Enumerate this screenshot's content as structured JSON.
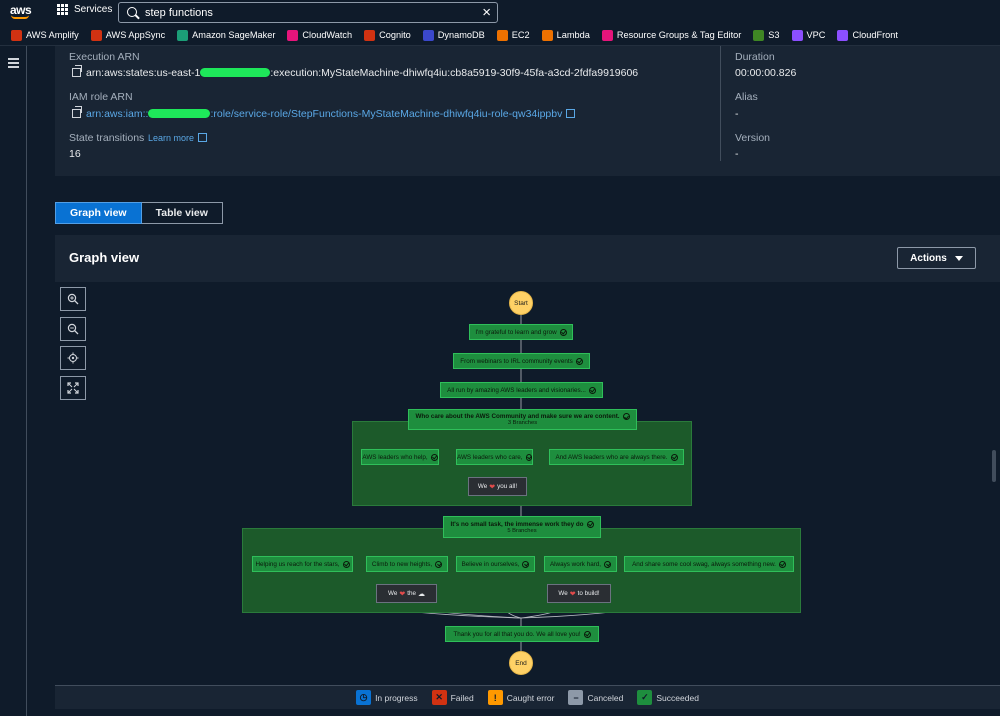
{
  "nav": {
    "logo": "aws",
    "services_label": "Services",
    "search_value": "step functions"
  },
  "favorites": [
    {
      "label": "AWS Amplify",
      "color": "#d13212"
    },
    {
      "label": "AWS AppSync",
      "color": "#d13212"
    },
    {
      "label": "Amazon SageMaker",
      "color": "#1b9e77"
    },
    {
      "label": "CloudWatch",
      "color": "#e7157b"
    },
    {
      "label": "Cognito",
      "color": "#d13212"
    },
    {
      "label": "DynamoDB",
      "color": "#3b48cc"
    },
    {
      "label": "EC2",
      "color": "#ed7100"
    },
    {
      "label": "Lambda",
      "color": "#ed7100"
    },
    {
      "label": "Resource Groups & Tag Editor",
      "color": "#e7157b"
    },
    {
      "label": "S3",
      "color": "#3f8624"
    },
    {
      "label": "VPC",
      "color": "#8c4fff"
    },
    {
      "label": "CloudFront",
      "color": "#8c4fff"
    }
  ],
  "details": {
    "execution_arn_label": "Execution ARN",
    "execution_arn_prefix": "arn:aws:states:us-east-1",
    "execution_arn_suffix": ":execution:MyStateMachine-dhiwfq4iu:cb8a5919-30f9-45fa-a3cd-2fdfa9919606",
    "iam_role_label": "IAM role ARN",
    "iam_role_prefix": "arn:aws:iam::",
    "iam_role_suffix": ":role/service-role/StepFunctions-MyStateMachine-dhiwfq4iu-role-qw34ippbv",
    "state_transitions_label": "State transitions",
    "learn_more": "Learn more",
    "state_transitions_value": "16",
    "duration_label": "Duration",
    "duration_value": "00:00:00.826",
    "alias_label": "Alias",
    "alias_value": "-",
    "version_label": "Version",
    "version_value": "-"
  },
  "tabs": {
    "graph": "Graph view",
    "table": "Table view"
  },
  "graph": {
    "title": "Graph view",
    "actions": "Actions",
    "start": "Start",
    "end": "End",
    "steps": {
      "s1": "I'm grateful to learn and grow",
      "s2": "From webinars to IRL community events",
      "s3": "All run by amazing AWS leaders and visionaries...",
      "p1_title": "Who care about the AWS Community and make sure we are content.",
      "p1_sub": "3 Branches",
      "b1a": "AWS leaders who help,",
      "b1b": "AWS leaders who care,",
      "b1c": "And AWS leaders who are always there.",
      "w1_pre": "We",
      "w1_post": "you all!",
      "p2_title": "It's no small task, the immense work they do",
      "p2_sub": "5 Branches",
      "b2a": "Helping us reach for the stars,",
      "b2b": "Climb to new heights,",
      "b2c": "Believe in ourselves,",
      "b2d": "Always work hard,",
      "b2e": "And share some cool swag, always something new.",
      "w2_pre": "We",
      "w2_post": "the",
      "w3_pre": "We",
      "w3_post": "to build!",
      "s_final": "Thank you for all that you do. We all love you!"
    }
  },
  "legend": [
    {
      "label": "In progress",
      "color": "#0972d3",
      "glyph": "◷"
    },
    {
      "label": "Failed",
      "color": "#d13212",
      "glyph": "✕"
    },
    {
      "label": "Caught error",
      "color": "#ff9900",
      "glyph": "!"
    },
    {
      "label": "Canceled",
      "color": "#8d99a8",
      "glyph": "−"
    },
    {
      "label": "Succeeded",
      "color": "#1e8e3e",
      "glyph": "✓"
    }
  ]
}
